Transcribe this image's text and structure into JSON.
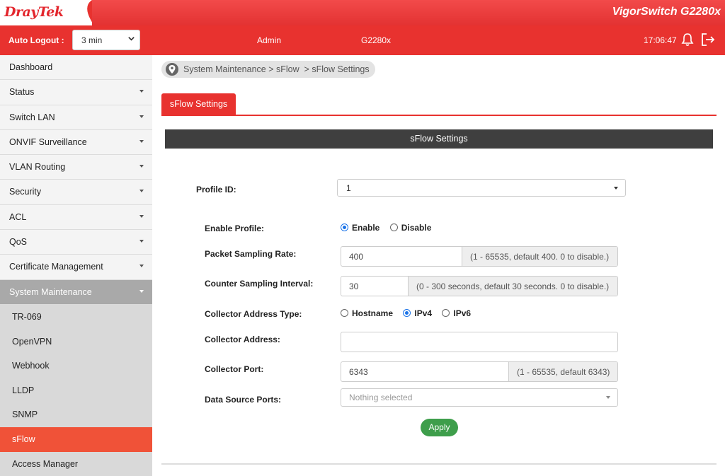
{
  "brand": {
    "logo_text": "DrayTek",
    "product_name": "VigorSwitch G2280x",
    "accent": "#e8322f"
  },
  "header": {
    "auto_logout_label": "Auto Logout :",
    "auto_logout_value": "3 min",
    "user": "Admin",
    "model": "G2280x",
    "time": "17:06:47",
    "icons": [
      "bell-icon",
      "logout-icon"
    ]
  },
  "sidebar": {
    "items": [
      {
        "label": "Dashboard",
        "has_arrow": false
      },
      {
        "label": "Status",
        "has_arrow": true
      },
      {
        "label": "Switch LAN",
        "has_arrow": true
      },
      {
        "label": "ONVIF Surveillance",
        "has_arrow": true
      },
      {
        "label": "VLAN Routing",
        "has_arrow": true
      },
      {
        "label": "Security",
        "has_arrow": true
      },
      {
        "label": "ACL",
        "has_arrow": true
      },
      {
        "label": "QoS",
        "has_arrow": true
      },
      {
        "label": "Certificate Management",
        "has_arrow": true
      },
      {
        "label": "System Maintenance",
        "has_arrow": true,
        "expanded": true
      }
    ],
    "sub_items": [
      {
        "label": "TR-069"
      },
      {
        "label": "OpenVPN"
      },
      {
        "label": "Webhook"
      },
      {
        "label": "LLDP"
      },
      {
        "label": "SNMP"
      },
      {
        "label": "sFlow",
        "current": true
      },
      {
        "label": "Access Manager"
      }
    ]
  },
  "breadcrumb": {
    "text": "System Maintenance > sFlow  > sFlow Settings",
    "icon": "map-pin-icon"
  },
  "tab": {
    "label": "sFlow Settings"
  },
  "section": {
    "title": "sFlow Settings"
  },
  "form": {
    "profile_id": {
      "label": "Profile ID:",
      "value": "1"
    },
    "enable_profile": {
      "label": "Enable Profile:",
      "options": [
        "Enable",
        "Disable"
      ],
      "selected": "Enable"
    },
    "packet_sampling_rate": {
      "label": "Packet Sampling Rate:",
      "value": "400",
      "hint": "(1 - 65535, default 400. 0 to disable.)"
    },
    "counter_sampling_interval": {
      "label": "Counter Sampling Interval:",
      "value": "30",
      "hint": "(0 - 300 seconds, default 30 seconds. 0 to disable.)"
    },
    "collector_address_type": {
      "label": "Collector Address Type:",
      "options": [
        "Hostname",
        "IPv4",
        "IPv6"
      ],
      "selected": "IPv4"
    },
    "collector_address": {
      "label": "Collector Address:",
      "value": ""
    },
    "collector_port": {
      "label": "Collector Port:",
      "value": "6343",
      "hint": "(1 - 65535, default 6343)"
    },
    "data_source_ports": {
      "label": "Data Source Ports:",
      "placeholder": "Nothing selected"
    },
    "apply_label": "Apply"
  }
}
